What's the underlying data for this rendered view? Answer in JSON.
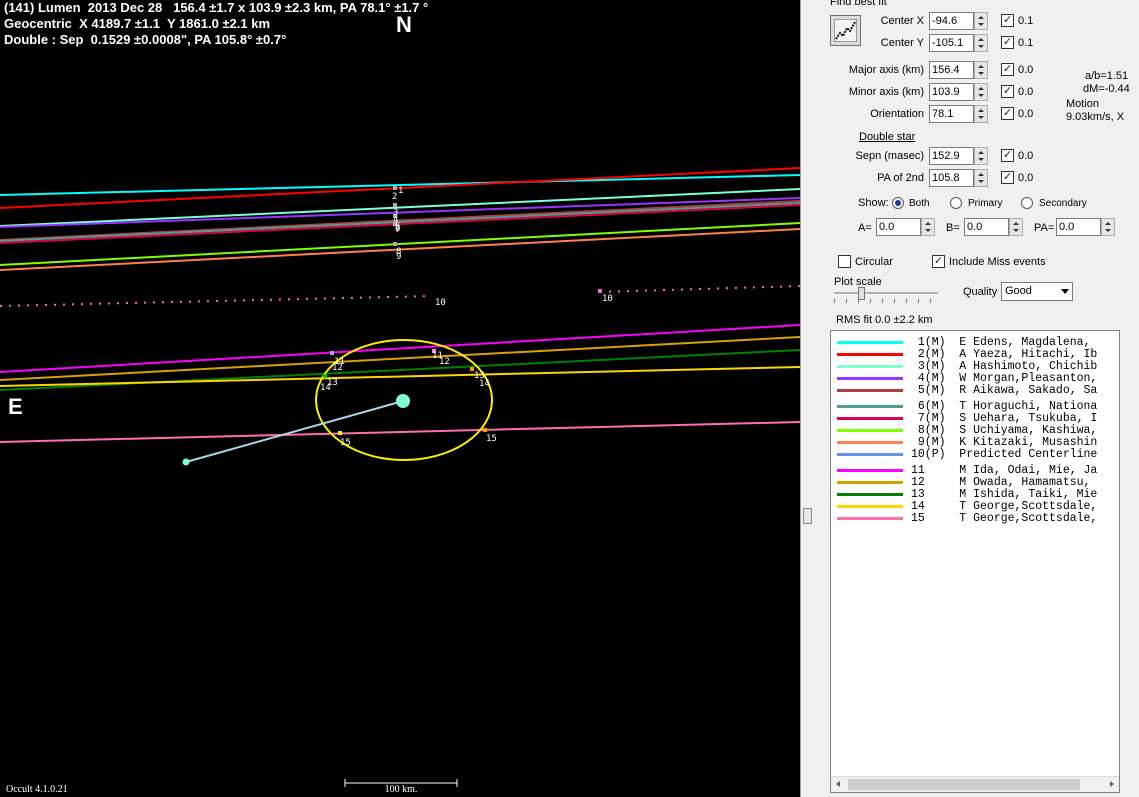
{
  "header": {
    "line1": "(141) Lumen  2013 Dec 28   156.4 ±1.7 x 103.9 ±2.3 km, PA 78.1° ±1.7 °",
    "line2": "Geocentric  X 4189.7 ±1.1  Y 1861.0 ±2.1 km",
    "line3": "Double : Sep  0.1529 ±0.0008\", PA 105.8° ±0.7°"
  },
  "compass": {
    "north": "N",
    "east": "E"
  },
  "version": "Occult 4.1.0.21",
  "scale_bar": {
    "label": "100 km."
  },
  "plot": {
    "chord_labels": [
      "1",
      "2",
      "3",
      "4",
      "5",
      "6",
      "7",
      "8",
      "9",
      "10",
      "10",
      "11",
      "12",
      "13",
      "14",
      "15",
      "11",
      "12",
      "13",
      "14",
      "15"
    ],
    "colors": {
      "c1": "#00ffff",
      "c2": "#ff0000",
      "c3": "#7fffd4",
      "c4": "#9933ff",
      "c5": "#b04040",
      "c6": "#4aa090",
      "c7": "#e0004a",
      "c8": "#80ff00",
      "c9": "#ff7f50",
      "c10": "#ff66cc",
      "c11": "#ff00ff",
      "c12": "#d9a000",
      "c13": "#008000",
      "c14": "#ffd700",
      "c15": "#ff6fb0",
      "ellipse": "#ffee00",
      "primary_dot": "#80ffd0",
      "separation_line": "#a8d8e8"
    }
  },
  "panel": {
    "find_best_fit": "Find best fit",
    "params": [
      {
        "label": "Center X",
        "value": "-94.6",
        "checked": true,
        "step": "0.1"
      },
      {
        "label": "Center Y",
        "value": "-105.1",
        "checked": true,
        "step": "0.1"
      },
      {
        "label": "Major axis (km)",
        "value": "156.4",
        "checked": true,
        "step": "0.0"
      },
      {
        "label": "Minor axis (km)",
        "value": "103.9",
        "checked": true,
        "step": "0.0"
      },
      {
        "label": "Orientation",
        "value": "78.1",
        "checked": true,
        "step": "0.0"
      },
      {
        "label": "Sepn (masec)",
        "value": "152.9",
        "checked": true,
        "step": "0.0"
      },
      {
        "label": "PA of 2nd",
        "value": "105.8",
        "checked": true,
        "step": "0.0"
      }
    ],
    "ratio": "a/b=1.51",
    "dm": "dM=-0.44",
    "motion_label": "Motion",
    "motion_value": "9.03km/s, X",
    "double_star": "Double star",
    "show_label": "Show:",
    "show_options": [
      "Both",
      "Primary",
      "Secondary"
    ],
    "show_selected": "Both",
    "a_label": "A=",
    "a_value": "0.0",
    "b_label": "B=",
    "b_value": "0.0",
    "pa_label": "PA=",
    "pa_value": "0.0",
    "circular": "Circular",
    "include_miss": "Include Miss events",
    "plot_scale": "Plot scale",
    "quality_label": "Quality",
    "quality_value": "Good",
    "rms": "RMS fit  0.0 ±2.2 km"
  },
  "legend": [
    {
      "text": " 1(M)  E Edens, Magdalena,",
      "color": "#00ffff"
    },
    {
      "text": " 2(M)  A Yaeza, Hitachi, Ib",
      "color": "#ff0000"
    },
    {
      "text": " 3(M)  A Hashimoto, Chichib",
      "color": "#7fffd4"
    },
    {
      "text": " 4(M)  W Morgan,Pleasanton,",
      "color": "#9933ff"
    },
    {
      "text": " 5(M)  R Aikawa, Sakado, Sa",
      "color": "#b04040"
    },
    {
      "text": " 6(M)  T Horaguchi, Nationa",
      "color": "#4aa090"
    },
    {
      "text": " 7(M)  S Uehara, Tsukuba, I",
      "color": "#e0004a"
    },
    {
      "text": " 8(M)  S Uchiyama, Kashiwa,",
      "color": "#80ff00"
    },
    {
      "text": " 9(M)  K Kitazaki, Musashin",
      "color": "#ff7f50"
    },
    {
      "text": "10(P)  Predicted Centerline",
      "color": "#6495ed"
    },
    {
      "text": "11     M Ida, Odai, Mie, Ja",
      "color": "#ff00ff"
    },
    {
      "text": "12     M Owada, Hamamatsu,",
      "color": "#d9a000"
    },
    {
      "text": "13     M Ishida, Taiki, Mie",
      "color": "#008000"
    },
    {
      "text": "14     T George,Scottsdale,",
      "color": "#ffd700"
    },
    {
      "text": "15     T George,Scottsdale,",
      "color": "#ff6fb0"
    }
  ]
}
